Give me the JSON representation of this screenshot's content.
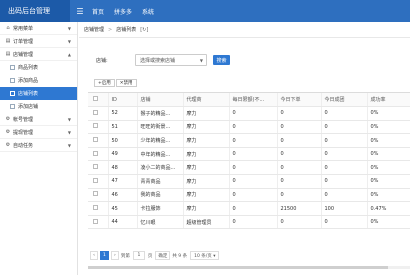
{
  "app": {
    "title": "出码后台管理",
    "menu_icon": "menu-icon"
  },
  "topnav": [
    {
      "label": "首页"
    },
    {
      "label": "拼多多"
    },
    {
      "label": "系统"
    }
  ],
  "sidebar": {
    "items": [
      {
        "label": "常用菜单",
        "icon": "home-icon"
      },
      {
        "label": "订单管理",
        "icon": "list-icon"
      },
      {
        "label": "店铺管理",
        "icon": "list-icon"
      }
    ],
    "subitems": [
      {
        "label": "商品列表"
      },
      {
        "label": "添加商品"
      },
      {
        "label": "店铺列表"
      },
      {
        "label": "添加店铺"
      }
    ],
    "more": [
      {
        "label": "帐号管理",
        "icon": "gear-icon"
      },
      {
        "label": "提现管理",
        "icon": "gear-icon"
      },
      {
        "label": "自动任务",
        "icon": "gear-icon"
      }
    ]
  },
  "breadcrumb": {
    "level1": "店铺管理",
    "sep": ">",
    "level2": "店铺列表",
    "refresh": "[↻]"
  },
  "filter": {
    "label": "店铺:",
    "select_placeholder": "选择或搜索店铺",
    "search_label": "搜索"
  },
  "toolbar": {
    "enable": "启用",
    "disable": "禁用"
  },
  "table": {
    "columns": [
      "ID",
      "店铺",
      "代理商",
      "每日限额(不...",
      "今日下单",
      "今日成团",
      "成功率"
    ],
    "rows": [
      [
        "52",
        "猴子的精品...",
        "摩力",
        "0",
        "0",
        "0",
        "0%"
      ],
      [
        "51",
        "旺旺的街景...",
        "摩力",
        "0",
        "0",
        "0",
        "0%"
      ],
      [
        "50",
        "少年的精品...",
        "摩力",
        "0",
        "0",
        "0",
        "0%"
      ],
      [
        "49",
        "中年的精品...",
        "摩力",
        "0",
        "0",
        "0",
        "0%"
      ],
      [
        "48",
        "凌小二的商品...",
        "摩力",
        "0",
        "0",
        "0",
        "0%"
      ],
      [
        "47",
        "青青商品",
        "摩力",
        "0",
        "0",
        "0",
        "0%"
      ],
      [
        "46",
        "我的商品",
        "摩力",
        "0",
        "0",
        "0",
        "0%"
      ],
      [
        "45",
        "卡拉服饰",
        "摩力",
        "0",
        "21500",
        "100",
        "0.47%"
      ],
      [
        "44",
        "忆川眼",
        "超级管理员",
        "0",
        "0",
        "0",
        "0%"
      ]
    ]
  },
  "pager": {
    "prev": "‹",
    "page": "1",
    "next": "›",
    "goto_label": "到第",
    "goto_value": "1",
    "page_unit": "页",
    "confirm": "确定",
    "total": "共 9 条",
    "page_size": "10 条/页 ▾"
  }
}
